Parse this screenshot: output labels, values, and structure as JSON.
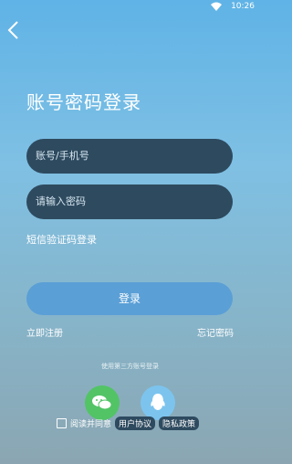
{
  "status": {
    "time": "10:26"
  },
  "login": {
    "title": "账号密码登录",
    "phone_placeholder": "账号/手机号",
    "password_placeholder": "请输入密码",
    "sms_login": "短信验证码登录",
    "button": "登录",
    "register": "立即注册",
    "forgot": "忘记密码",
    "third_party": "使用第三方账号登录"
  },
  "agreement": {
    "prefix": "阅读并同意",
    "user_agreement": "用户协议",
    "privacy_policy": "隐私政策"
  },
  "colors": {
    "field_bg": "#2e4a5f",
    "button_bg": "#5a9fd6",
    "wechat": "#52c466",
    "qq": "#7cc4ee"
  }
}
